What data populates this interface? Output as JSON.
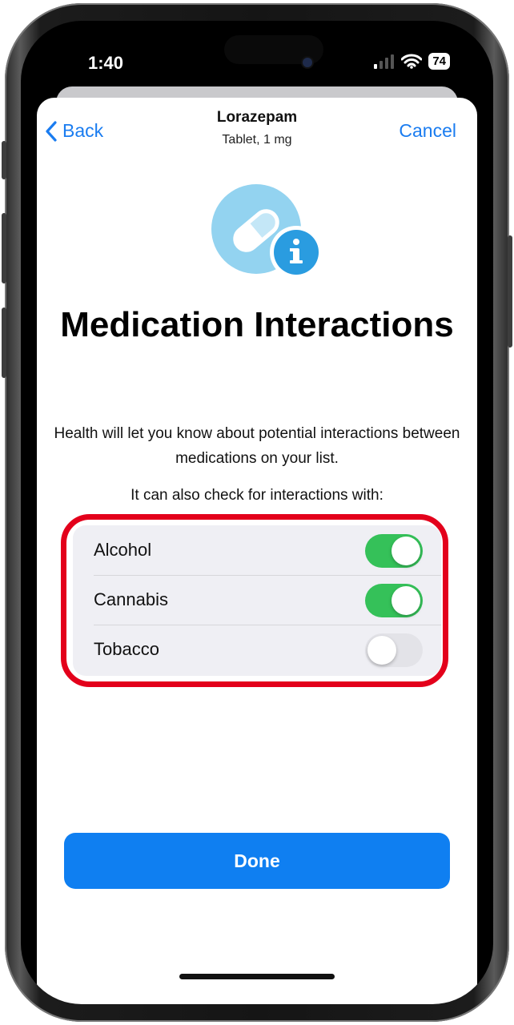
{
  "status_bar": {
    "time": "1:40",
    "battery": "74"
  },
  "nav": {
    "back_label": "Back",
    "title": "Lorazepam",
    "subtitle": "Tablet, 1 mg",
    "cancel_label": "Cancel"
  },
  "main": {
    "heading": "Medication Interactions",
    "description": "Health will let you know about potential interactions between medications on your list.",
    "prompt": "It can also check for interactions with:",
    "toggles": [
      {
        "label": "Alcohol",
        "on": true
      },
      {
        "label": "Cannabis",
        "on": true
      },
      {
        "label": "Tobacco",
        "on": false
      }
    ]
  },
  "footer": {
    "done_label": "Done"
  },
  "colors": {
    "accent": "#1a7cf0",
    "toggle_on": "#35c159",
    "highlight": "#e3001b",
    "icon_light": "#93d3f0",
    "icon_badge": "#2a9ce0"
  },
  "icons": [
    "chevron-left-icon",
    "pill-icon",
    "info-icon",
    "signal-icon",
    "wifi-icon"
  ]
}
